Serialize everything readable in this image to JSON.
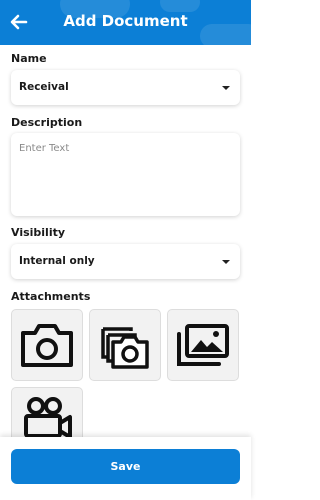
{
  "header": {
    "title": "Add Document",
    "back_icon": "arrow-left-icon"
  },
  "form": {
    "name": {
      "label": "Name",
      "value": "Receival"
    },
    "description": {
      "label": "Description",
      "placeholder": "Enter Text"
    },
    "visibility": {
      "label": "Visibility",
      "value": "Internal only"
    },
    "attachments": {
      "label": "Attachments",
      "options": [
        {
          "icon": "camera-icon"
        },
        {
          "icon": "multiple-photos-icon"
        },
        {
          "icon": "gallery-icon"
        },
        {
          "icon": "video-camera-icon"
        }
      ]
    }
  },
  "footer": {
    "save_label": "Save"
  },
  "colors": {
    "primary": "#0c7fd6",
    "tile_bg": "#f2f2f2"
  }
}
